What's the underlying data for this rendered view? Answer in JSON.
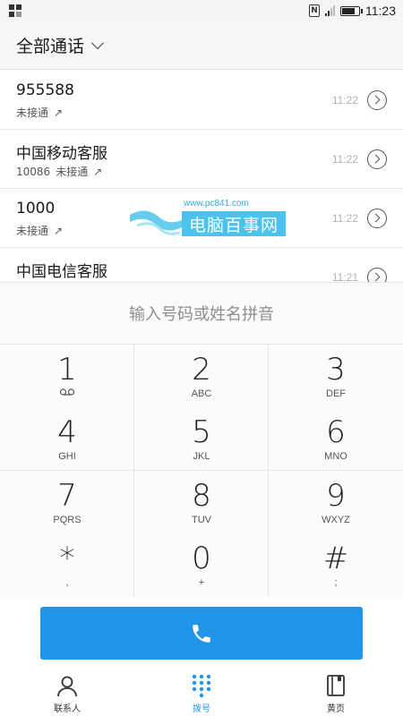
{
  "status_bar": {
    "nfc_label": "N",
    "battery_level": 0.85,
    "time": "11:23"
  },
  "header": {
    "title": "全部通话"
  },
  "call_log": [
    {
      "name": "955588",
      "sub_number": "",
      "status": "未接通",
      "time": "11:22"
    },
    {
      "name": "中国移动客服",
      "sub_number": "10086",
      "status": "未接通",
      "time": "11:22"
    },
    {
      "name": "1000",
      "sub_number": "",
      "status": "未接通",
      "time": "11:22"
    },
    {
      "name": "中国电信客服",
      "sub_number": "",
      "status": "",
      "time": "11:21"
    }
  ],
  "watermark": {
    "url": "www.pc841.com",
    "text": "电脑百事网"
  },
  "dial_input": {
    "placeholder": "输入号码或姓名拼音"
  },
  "keypad": [
    {
      "digit": "1",
      "letters": ""
    },
    {
      "digit": "2",
      "letters": "ABC"
    },
    {
      "digit": "3",
      "letters": "DEF"
    },
    {
      "digit": "4",
      "letters": "GHI"
    },
    {
      "digit": "5",
      "letters": "JKL"
    },
    {
      "digit": "6",
      "letters": "MNO"
    },
    {
      "digit": "7",
      "letters": "PQRS"
    },
    {
      "digit": "8",
      "letters": "TUV"
    },
    {
      "digit": "9",
      "letters": "WXYZ"
    },
    {
      "digit": "*",
      "letters": ","
    },
    {
      "digit": "0",
      "letters": "+"
    },
    {
      "digit": "#",
      "letters": ";"
    }
  ],
  "bottom_nav": {
    "contacts": "联系人",
    "dial": "拨号",
    "yellow_pages": "黄页"
  },
  "colors": {
    "accent": "#2196e8",
    "watermark": "#4cc3ea"
  }
}
